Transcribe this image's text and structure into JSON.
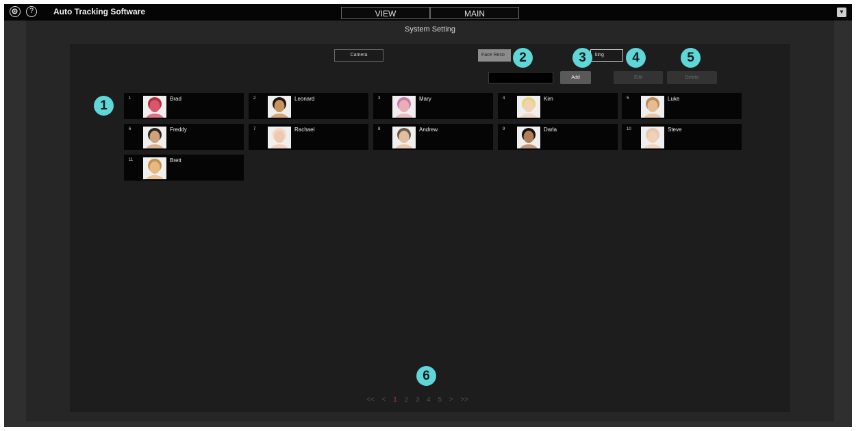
{
  "titlebar": {
    "settings_icon": "gear-icon",
    "help_glyph": "?",
    "app_title": "Auto Tracking Software",
    "tabs": [
      {
        "label": "VIEW"
      },
      {
        "label": "MAIN"
      }
    ],
    "menu_icon": "dropdown-icon"
  },
  "page_title": "System Setting",
  "toolbar": {
    "camera_tab": "Camera",
    "face_recognition_tab": "Face Reco",
    "tracking_tab": "king",
    "name_input_value": "",
    "add_button": "Add",
    "edit_button": "Edit",
    "delete_button": "Delete"
  },
  "faces": [
    {
      "number": "1",
      "name": "Brad",
      "skin": "#d9556a",
      "hair": "#b03040"
    },
    {
      "number": "2",
      "name": "Leonard",
      "skin": "#c8945e",
      "hair": "#1e1410"
    },
    {
      "number": "3",
      "name": "Mary",
      "skin": "#e8b0b4",
      "hair": "#c77bb0"
    },
    {
      "number": "4",
      "name": "Kim",
      "skin": "#f1d2b4",
      "hair": "#e8d47a"
    },
    {
      "number": "5",
      "name": "Luke",
      "skin": "#e6bc94",
      "hair": "#c08a54"
    },
    {
      "number": "6",
      "name": "Freddy",
      "skin": "#cfa27a",
      "hair": "#2a2420"
    },
    {
      "number": "7",
      "name": "Rachael",
      "skin": "#f0c8b0",
      "hair": "#f2d8c4"
    },
    {
      "number": "8",
      "name": "Andrew",
      "skin": "#e4bea0",
      "hair": "#6b5a4a"
    },
    {
      "number": "9",
      "name": "Darla",
      "skin": "#b07e5a",
      "hair": "#141008"
    },
    {
      "number": "10",
      "name": "Steve",
      "skin": "#f0d0b6",
      "hair": "#e6c8b0"
    },
    {
      "number": "11",
      "name": "Brett",
      "skin": "#e8b882",
      "hair": "#c8914f"
    }
  ],
  "callouts": [
    "1",
    "2",
    "3",
    "4",
    "5",
    "6"
  ],
  "pagination": {
    "first": "<<",
    "prev": "<",
    "pages": [
      "1",
      "2",
      "3",
      "4",
      "5"
    ],
    "current": "1",
    "next": ">",
    "last": ">>"
  },
  "colors": {
    "accent_callout": "#5fd6d8",
    "current_page": "#d0303a"
  }
}
